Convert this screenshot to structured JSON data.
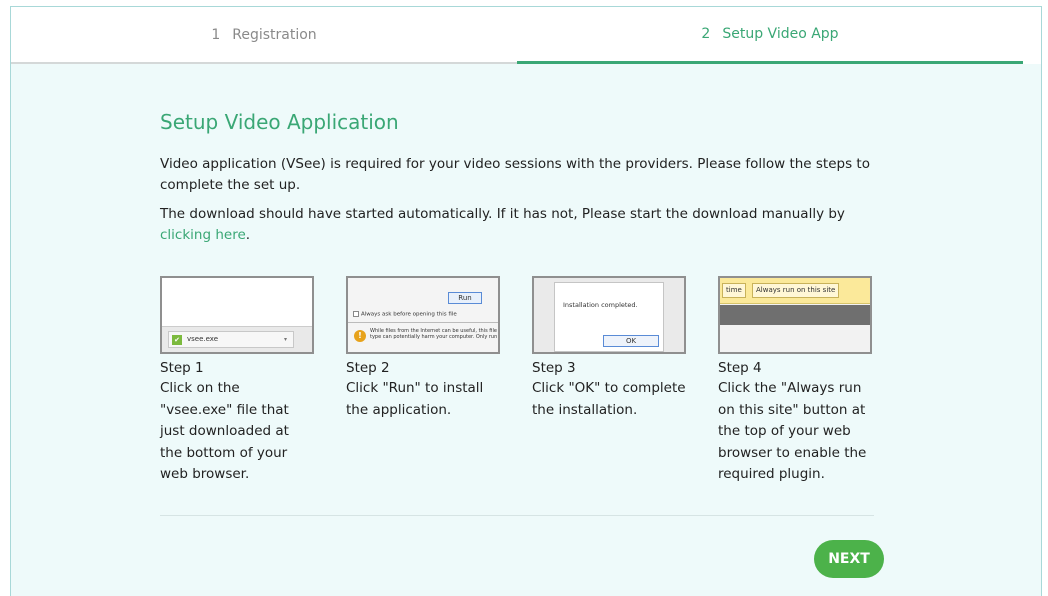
{
  "tabs": [
    {
      "num": "1",
      "label": "Registration",
      "active": false
    },
    {
      "num": "2",
      "label": "Setup Video App",
      "active": true
    }
  ],
  "content": {
    "title": "Setup Video Application",
    "intro": "Video application (VSee) is required for your video sessions with the providers. Please follow the steps to complete the set up.",
    "download_prefix": "The download should have started automatically. If it has not, Please start the download manually by ",
    "download_link": "clicking here",
    "download_suffix": "."
  },
  "steps": [
    {
      "title": "Step 1",
      "text": "Click on the \"vsee.exe\" file that just downloaded at the bottom of your web browser.",
      "shot": {
        "file_name": "vsee.exe"
      }
    },
    {
      "title": "Step 2",
      "text": "Click \"Run\" to install the application.",
      "shot": {
        "run_label": "Run",
        "checkbox_label": "Always ask before opening this file",
        "warning_text": "While files from the Internet can be useful, this file type can potentially harm your computer. Only run"
      }
    },
    {
      "title": "Step 3",
      "text": "Click \"OK\" to complete the installation.",
      "shot": {
        "dialog_text": "Installation completed.",
        "ok_label": "OK"
      }
    },
    {
      "title": "Step 4",
      "text": "Click the \"Always run on this site\" button at the top of your web browser to enable the required plugin.",
      "shot": {
        "btn_time": "time",
        "btn_always": "Always run on this site"
      }
    }
  ],
  "actions": {
    "next_label": "NEXT"
  },
  "colors": {
    "accent": "#3aa775",
    "button": "#4cb24a",
    "background": "#eefafa"
  }
}
